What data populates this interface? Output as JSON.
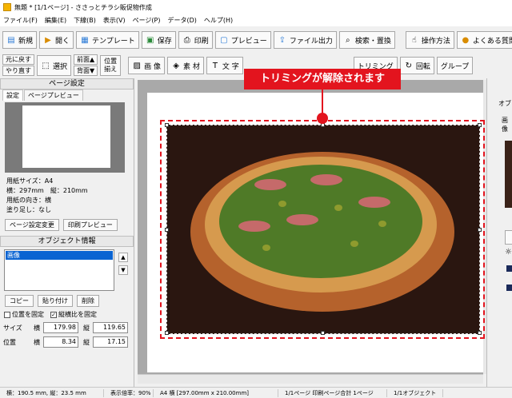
{
  "window": {
    "title": "無題 * [1/1ページ] - ささっとチラシ販促物作成"
  },
  "menu": [
    "ファイル(F)",
    "編集(E)",
    "下線(B)",
    "表示(V)",
    "ページ(P)",
    "データ(D)",
    "ヘルプ(H)"
  ],
  "toolbar1": {
    "new": "新規",
    "open": "開く",
    "template": "テンプレート",
    "save": "保存",
    "print": "印刷",
    "preview": "プレビュー",
    "file_out": "ファイル出力",
    "search": "検索・置換",
    "howto": "操作方法",
    "faq": "よくある質問"
  },
  "toolbar2": {
    "undo": "元に戻す",
    "redo": "やり直す",
    "select": "選択",
    "front": "前面▲",
    "back": "背面▼",
    "align1": "位置",
    "align2": "揃え",
    "image": "画 像",
    "material": "素 材",
    "text": "文 字",
    "trim": "トリミング",
    "rotate": "回転",
    "group": "グループ"
  },
  "callout": "トリミングが解除されます",
  "page_settings": {
    "header": "ページ設定",
    "tab_settings": "設定",
    "tab_preview": "ページプレビュー",
    "paper_size": "用紙サイズ：A4",
    "dims": "横：297mm　縦：210mm",
    "orientation": "用紙の向き：横",
    "bleed": "塗り足し：なし",
    "change_btn": "ページ設定変更",
    "print_preview_btn": "印刷プレビュー"
  },
  "object_info": {
    "header": "オブジェクト情報",
    "selected": "画像",
    "copy": "コピー",
    "paste": "貼り付け",
    "delete": "削除",
    "lock_pos": "位置を固定",
    "lock_ratio": "縦横比を固定",
    "size_label": "サイズ",
    "pos_label": "位置",
    "w_label": "横",
    "h_label": "縦",
    "size_w": "179.98",
    "size_h": "119.65",
    "pos_x": "8.34",
    "pos_y": "17.15"
  },
  "right_panel": {
    "label1": "オブ",
    "label2": "画像"
  },
  "status": {
    "coords": "横：190.5 mm, 縦：23.5 mm",
    "zoom": "表示倍率：90%",
    "paper": "A4 横 [297.00mm x 210.00mm]",
    "pages": "1/1ページ 印刷ページ合計 1ページ",
    "objects": "1/1オブジェクト"
  }
}
